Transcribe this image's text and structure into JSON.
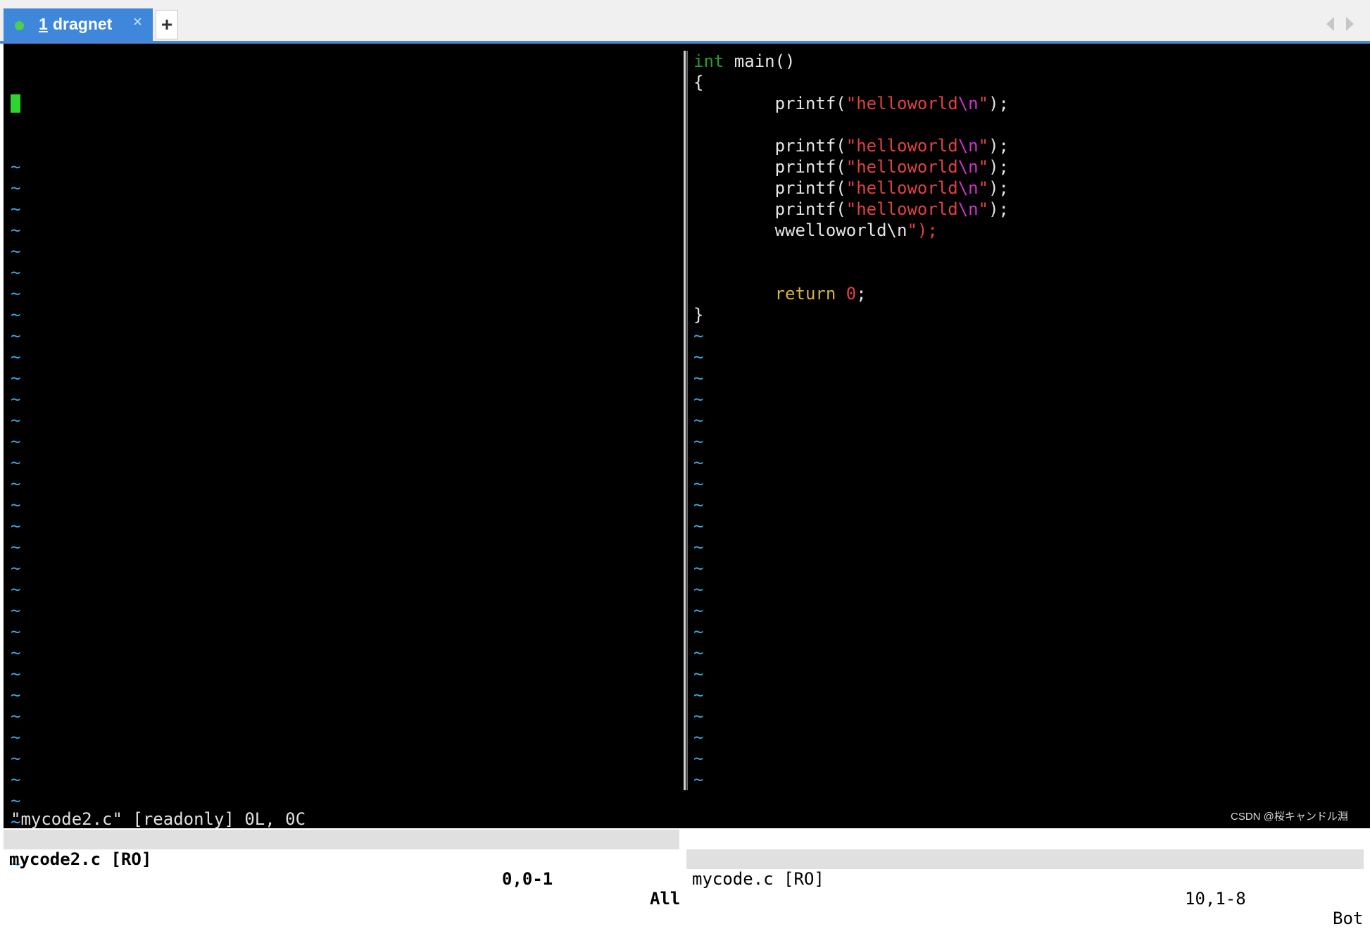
{
  "tabbar": {
    "tab": {
      "number": "1",
      "name": "dragnet",
      "close": "×"
    },
    "new_tab": "+"
  },
  "left_pane": {
    "tilde_char": "~",
    "tilde_count": 34
  },
  "right_pane": {
    "code_lines": [
      [
        {
          "t": "int",
          "c": "kw-type"
        },
        {
          "t": " main()",
          "c": "plain"
        }
      ],
      [
        {
          "t": "{",
          "c": "plain"
        }
      ],
      [
        {
          "t": "        printf(",
          "c": "plain"
        },
        {
          "t": "\"helloworld",
          "c": "str"
        },
        {
          "t": "\\n",
          "c": "esc"
        },
        {
          "t": "\"",
          "c": "str"
        },
        {
          "t": ");",
          "c": "plain"
        }
      ],
      [
        {
          "t": "",
          "c": "plain"
        }
      ],
      [
        {
          "t": "        printf(",
          "c": "plain"
        },
        {
          "t": "\"helloworld",
          "c": "str"
        },
        {
          "t": "\\n",
          "c": "esc"
        },
        {
          "t": "\"",
          "c": "str"
        },
        {
          "t": ");",
          "c": "plain"
        }
      ],
      [
        {
          "t": "        printf(",
          "c": "plain"
        },
        {
          "t": "\"helloworld",
          "c": "str"
        },
        {
          "t": "\\n",
          "c": "esc"
        },
        {
          "t": "\"",
          "c": "str"
        },
        {
          "t": ");",
          "c": "plain"
        }
      ],
      [
        {
          "t": "        printf(",
          "c": "plain"
        },
        {
          "t": "\"helloworld",
          "c": "str"
        },
        {
          "t": "\\n",
          "c": "esc"
        },
        {
          "t": "\"",
          "c": "str"
        },
        {
          "t": ");",
          "c": "plain"
        }
      ],
      [
        {
          "t": "        printf(",
          "c": "plain"
        },
        {
          "t": "\"helloworld",
          "c": "str"
        },
        {
          "t": "\\n",
          "c": "esc"
        },
        {
          "t": "\"",
          "c": "str"
        },
        {
          "t": ");",
          "c": "plain"
        }
      ],
      [
        {
          "t": "        wwelloworld\\n",
          "c": "plain"
        },
        {
          "t": "\");",
          "c": "str"
        }
      ],
      [
        {
          "t": "",
          "c": "plain"
        }
      ],
      [
        {
          "t": "",
          "c": "plain"
        }
      ],
      [
        {
          "t": "        ",
          "c": "plain"
        },
        {
          "t": "return",
          "c": "kw-ret"
        },
        {
          "t": " ",
          "c": "plain"
        },
        {
          "t": "0",
          "c": "num-lit"
        },
        {
          "t": ";",
          "c": "plain"
        }
      ],
      [
        {
          "t": "}",
          "c": "plain"
        }
      ]
    ],
    "tilde_count": 22
  },
  "status": {
    "left": {
      "filename": "mycode2.c [RO]",
      "position": "0,0-1",
      "percent": "All"
    },
    "right": {
      "filename": "mycode.c [RO]",
      "position": "10,1-8",
      "percent": "Bot"
    }
  },
  "cmdline": "\"mycode2.c\" [readonly] 0L, 0C",
  "watermark": "CSDN @桜キャンドル淵"
}
